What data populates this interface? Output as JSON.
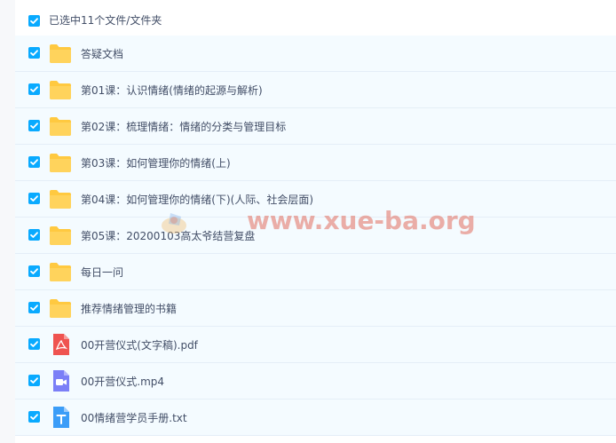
{
  "header": {
    "selection_text": "已选中11个文件/文件夹"
  },
  "files": [
    {
      "name": "答疑文档",
      "icon": "folder-icon"
    },
    {
      "name": "第01课：认识情绪(情绪的起源与解析)",
      "icon": "folder-icon"
    },
    {
      "name": "第02课：梳理情绪：情绪的分类与管理目标",
      "icon": "folder-icon"
    },
    {
      "name": "第03课：如何管理你的情绪(上)",
      "icon": "folder-icon"
    },
    {
      "name": "第04课：如何管理你的情绪(下)(人际、社会层面)",
      "icon": "folder-icon"
    },
    {
      "name": "第05课：20200103高太爷结营复盘",
      "icon": "folder-icon"
    },
    {
      "name": "每日一问",
      "icon": "folder-icon"
    },
    {
      "name": "推荐情绪管理的书籍",
      "icon": "folder-icon"
    },
    {
      "name": "00开营仪式(文字稿).pdf",
      "icon": "pdf-file-icon"
    },
    {
      "name": "00开营仪式.mp4",
      "icon": "video-file-icon"
    },
    {
      "name": "00情绪营学员手册.txt",
      "icon": "text-file-icon"
    }
  ],
  "watermark": {
    "text": "www.xue-ba.org"
  },
  "colors": {
    "checkbox": "#09aaff",
    "folder": "#ffc940",
    "pdf": "#ef5350",
    "video": "#7b7ff7",
    "txt": "#3b9df8",
    "row_bg": "#f4fbff"
  }
}
